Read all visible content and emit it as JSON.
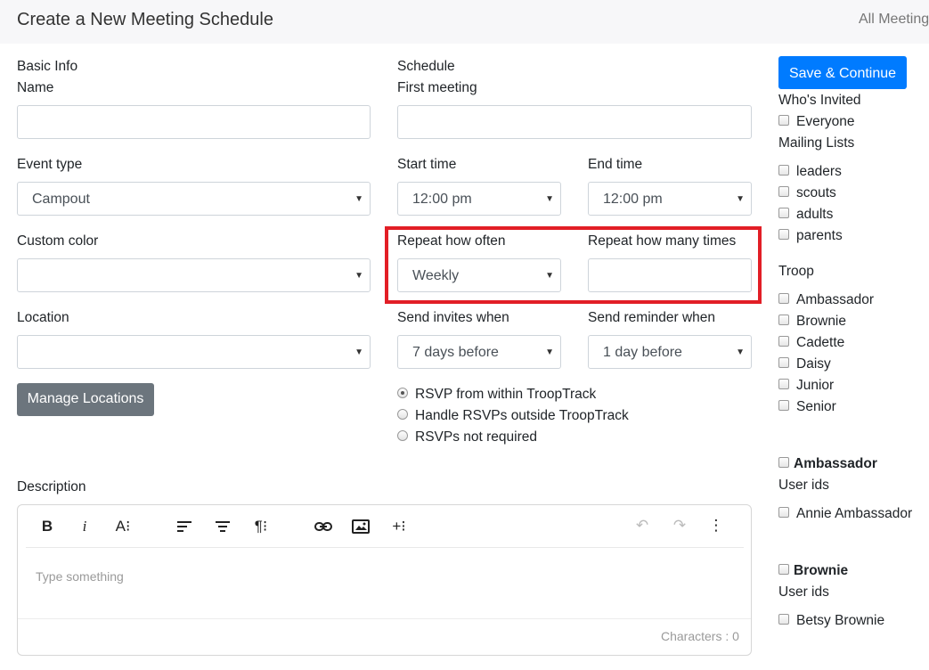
{
  "header": {
    "title": "Create a New Meeting Schedule",
    "all_meetings": "All Meeting"
  },
  "basic": {
    "section_label": "Basic Info",
    "name_label": "Name",
    "name_value": "",
    "event_type_label": "Event type",
    "event_type_value": "Campout",
    "custom_color_label": "Custom color",
    "custom_color_value": "",
    "location_label": "Location",
    "location_value": "",
    "manage_locations": "Manage Locations"
  },
  "schedule": {
    "section_label": "Schedule",
    "first_meeting_label": "First meeting",
    "first_meeting_value": "",
    "start_time_label": "Start time",
    "start_time_value": "12:00 pm",
    "end_time_label": "End time",
    "end_time_value": "12:00 pm",
    "repeat_often_label": "Repeat how often",
    "repeat_often_value": "Weekly",
    "repeat_times_label": "Repeat how many times",
    "repeat_times_value": "",
    "invites_label": "Send invites when",
    "invites_value": "7 days before",
    "reminder_label": "Send reminder when",
    "reminder_value": "1 day before",
    "rsvp_options": [
      {
        "label": "RSVP from within TroopTrack",
        "selected": true
      },
      {
        "label": "Handle RSVPs outside TroopTrack",
        "selected": false
      },
      {
        "label": "RSVPs not required",
        "selected": false
      }
    ]
  },
  "description": {
    "label": "Description",
    "placeholder": "Type something",
    "char_count": "Characters : 0",
    "toolbar": {
      "bold": "B",
      "italic": "i",
      "font_size": "A⁝",
      "align": "☰",
      "paragraph": "¶⁝",
      "more": "+⁝",
      "menu": "⋮",
      "undo": "↶",
      "redo": "↷"
    }
  },
  "sidebar": {
    "save_button": "Save & Continue",
    "whos_invited_label": "Who's Invited",
    "everyone": "Everyone",
    "mailing_lists_label": "Mailing Lists",
    "mailing_lists": [
      "leaders",
      "scouts",
      "adults",
      "parents"
    ],
    "troop_label": "Troop",
    "troops": [
      "Ambassador",
      "Brownie",
      "Cadette",
      "Daisy",
      "Junior",
      "Senior"
    ],
    "groups": [
      {
        "name": "Ambassador",
        "user_ids_label": "User ids",
        "users": [
          "Annie Ambassador"
        ]
      },
      {
        "name": "Brownie",
        "user_ids_label": "User ids",
        "users": [
          "Betsy Brownie"
        ]
      }
    ]
  },
  "colors": {
    "primary": "#007bff",
    "secondary": "#6c757d",
    "highlight": "#e21e26"
  }
}
